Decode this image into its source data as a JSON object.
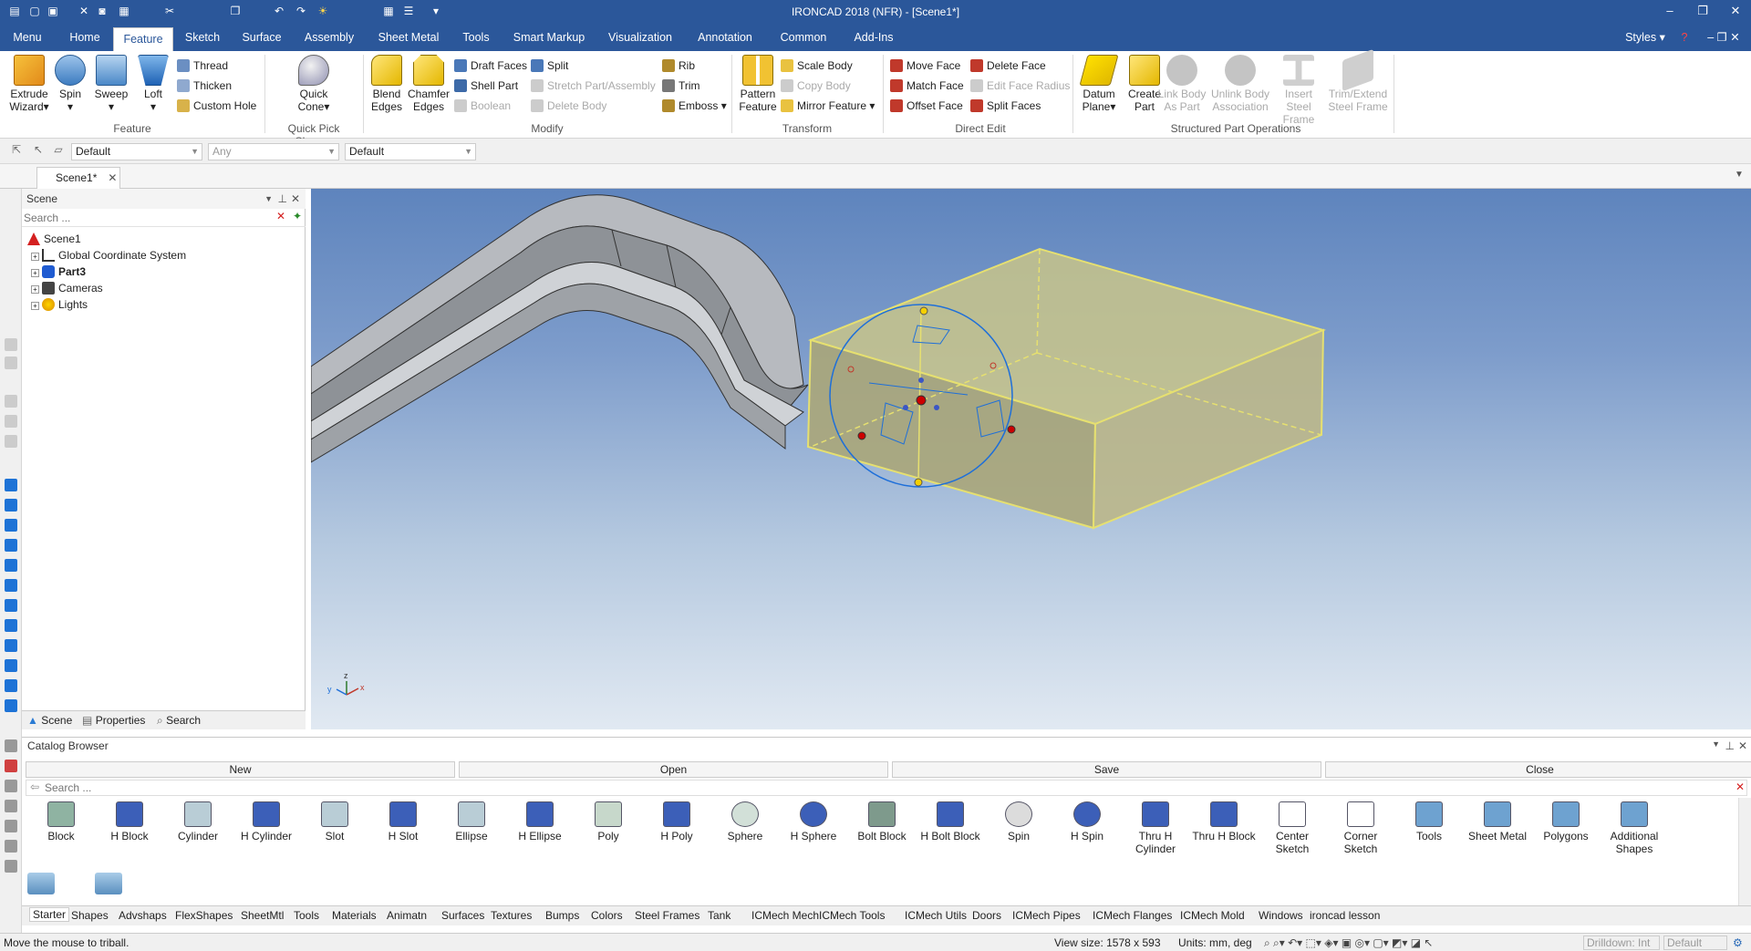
{
  "window": {
    "title": "IRONCAD 2018 (NFR) - [Scene1*]"
  },
  "menu": {
    "tabs": [
      "Menu",
      "Home",
      "Feature",
      "Sketch",
      "Surface",
      "Assembly",
      "Sheet Metal",
      "Tools",
      "Smart Markup",
      "Visualization",
      "Annotation",
      "Common",
      "Add-Ins"
    ],
    "active": "Feature",
    "styles": "Styles"
  },
  "ribbon": {
    "feature": {
      "label": "Feature",
      "big": [
        [
          "Extrude",
          "Wizard"
        ],
        [
          "Spin",
          ""
        ],
        [
          "Sweep",
          ""
        ],
        [
          "Loft",
          ""
        ]
      ],
      "small": [
        "Thread",
        "Thicken",
        "Custom Hole"
      ]
    },
    "quickpick": {
      "label": "Quick Pick Shapes",
      "big": [
        "Quick",
        "Cone"
      ]
    },
    "modify": {
      "label": "Modify",
      "big": [
        [
          "Blend",
          "Edges"
        ],
        [
          "Chamfer",
          "Edges"
        ]
      ],
      "col1": [
        "Draft Faces",
        "Shell Part",
        "Boolean"
      ],
      "col2": [
        "Split",
        "Stretch Part/Assembly",
        "Delete Body"
      ],
      "col3": [
        "Rib",
        "Trim",
        "Emboss"
      ]
    },
    "transform": {
      "label": "Transform",
      "big": [
        "Pattern",
        "Feature"
      ],
      "small": [
        "Scale Body",
        "Copy Body",
        "Mirror Feature"
      ]
    },
    "directedit": {
      "label": "Direct Edit",
      "col1": [
        "Move Face",
        "Match Face",
        "Offset Face"
      ],
      "col2": [
        "Delete Face",
        "Edit Face Radius",
        "Split Faces"
      ]
    },
    "structured": {
      "label": "Structured Part Operations",
      "big": [
        [
          "Datum",
          "Plane"
        ],
        [
          "Create",
          "Part"
        ],
        [
          "Link Body",
          "As Part"
        ],
        [
          "Unlink Body",
          "Association"
        ],
        [
          "Insert Steel",
          "Frame"
        ],
        [
          "Trim/Extend",
          "Steel Frame"
        ]
      ]
    }
  },
  "toolbar2": {
    "combo1": "Default",
    "combo2": "Any",
    "combo3": "Default"
  },
  "doc": {
    "tab": "Scene1*"
  },
  "scene": {
    "title": "Scene",
    "search_placeholder": "Search ...",
    "tree": [
      "Scene1",
      "Global Coordinate System",
      "Part3",
      "Cameras",
      "Lights"
    ],
    "footer_tabs": [
      "Scene",
      "Properties",
      "Search"
    ]
  },
  "catalog": {
    "title": "Catalog Browser",
    "buttons": [
      "New",
      "Open",
      "Save",
      "Close"
    ],
    "search_placeholder": "Search ...",
    "items": [
      [
        "Block",
        ""
      ],
      [
        "H Block",
        ""
      ],
      [
        "Cylinder",
        ""
      ],
      [
        "H Cylinder",
        ""
      ],
      [
        "Slot",
        ""
      ],
      [
        "H Slot",
        ""
      ],
      [
        "Ellipse",
        ""
      ],
      [
        "H Ellipse",
        ""
      ],
      [
        "Poly",
        ""
      ],
      [
        "H Poly",
        ""
      ],
      [
        "Sphere",
        ""
      ],
      [
        "H Sphere",
        ""
      ],
      [
        "Bolt Block",
        ""
      ],
      [
        "H Bolt Block",
        ""
      ],
      [
        "Spin",
        ""
      ],
      [
        "H Spin",
        ""
      ],
      [
        "Thru H",
        "Cylinder"
      ],
      [
        "Thru H Block",
        ""
      ],
      [
        "Center",
        "Sketch"
      ],
      [
        "Corner",
        "Sketch"
      ],
      [
        "Tools",
        ""
      ],
      [
        "Sheet Metal",
        ""
      ],
      [
        "Polygons",
        ""
      ],
      [
        "Additional",
        "Shapes"
      ]
    ],
    "tabs": [
      "Starter",
      "Shapes",
      "Advshaps",
      "FlexShapes",
      "SheetMtl",
      "Tools",
      "Materials",
      "Animatn",
      "Surfaces",
      "Textures",
      "Bumps",
      "Colors",
      "Steel Frames",
      "Tank",
      "ICMech Mech",
      "ICMech Tools",
      "ICMech Utils",
      "Doors",
      "ICMech  Pipes",
      "ICMech Flanges",
      "ICMech Mold",
      "Windows",
      "ironcad lesson"
    ]
  },
  "status": {
    "message": "Move the mouse to triball.",
    "viewsize": "View size: 1578 x  593",
    "units": "Units: mm, deg",
    "drilldown": "Drilldown: Int",
    "default": "Default"
  },
  "colors": {
    "accent": "#2b579a",
    "selection": "#e6e070",
    "triball": "#1e6fd9"
  }
}
